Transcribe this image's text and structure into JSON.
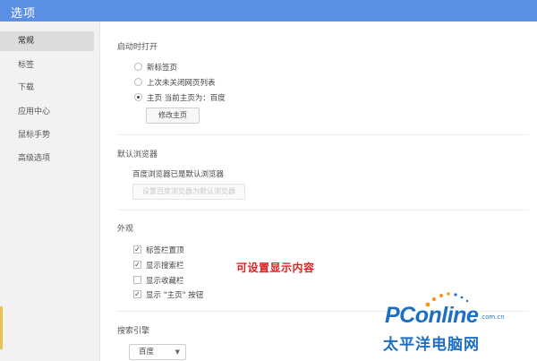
{
  "window": {
    "title": "选项"
  },
  "sidebar": {
    "items": [
      {
        "label": "常规",
        "active": true
      },
      {
        "label": "标签"
      },
      {
        "label": "下载"
      },
      {
        "label": "应用中心"
      },
      {
        "label": "鼠标手势"
      },
      {
        "label": "高级选项"
      }
    ]
  },
  "startup": {
    "title": "启动时打开",
    "options": [
      {
        "label": "新标签页",
        "selected": false
      },
      {
        "label": "上次未关闭网页列表",
        "selected": false
      },
      {
        "label": "主页  当前主页为：百度",
        "selected": true
      }
    ],
    "modify_button": "修改主页"
  },
  "default_browser": {
    "title": "默认浏览器",
    "status": "百度浏览器已是默认浏览器",
    "set_button": "设置百度浏览器为默认浏览器"
  },
  "appearance": {
    "title": "外观",
    "options": [
      {
        "label": "标签栏置顶",
        "checked": true
      },
      {
        "label": "显示搜索栏",
        "checked": true
      },
      {
        "label": "显示收藏栏",
        "checked": false
      },
      {
        "label": "显示 \"主页\" 按钮",
        "checked": true
      }
    ],
    "annotation": "可设置显示内容"
  },
  "search_engine": {
    "title": "搜索引擎",
    "selected": "百度"
  },
  "watermark": {
    "brand": "PConline",
    "domain": ".com.cn",
    "cn_name": "太平洋电脑网"
  },
  "colors": {
    "titlebar": "#5b8fe6",
    "annotation": "#e02020",
    "brand": "#1d6fc4",
    "brand_accent": "#f29a1b"
  }
}
